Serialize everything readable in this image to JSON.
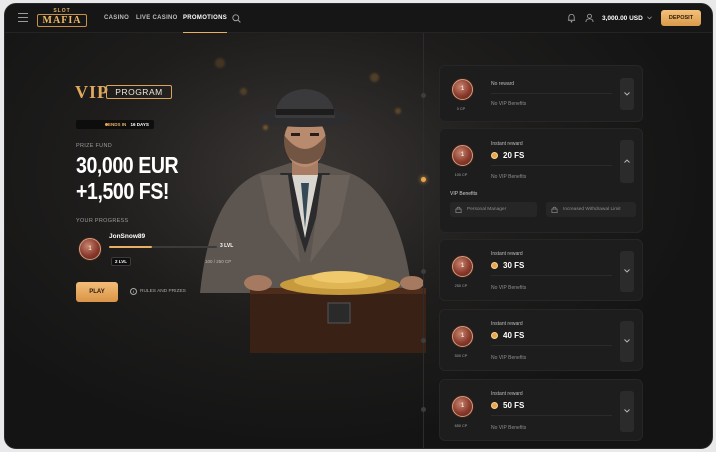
{
  "header": {
    "logo_top": "SLOT",
    "logo_main": "MAFIA",
    "nav": [
      "CASINO",
      "LIVE CASINO",
      "PROMOTIONS"
    ],
    "balance": "3,000.00 USD",
    "deposit_label": "DEPOSIT",
    "icons": [
      "menu-icon",
      "search-icon",
      "bell-icon",
      "user-icon",
      "chevron-down-icon"
    ]
  },
  "promo": {
    "vip_word": "VIP",
    "program_word": "PROGRAM",
    "ends_label": "ENDS IN",
    "ends_value": "16 DAYS",
    "prize_fund_label": "PRIZE FUND",
    "prize_line1": "30,000 EUR",
    "prize_line2": "+1,500 FS!",
    "your_progress_label": "YOUR PROGRESS",
    "user_level": "1",
    "username": "JonSnow89",
    "next_level": "3 LVL",
    "current_level_badge": "2 LVL",
    "cp_count": "100 / 250 CP",
    "progress_fraction": 0.4,
    "play_label": "PLAY",
    "rules_label": "RULES AND PRIZES"
  },
  "levels": [
    {
      "coin": "1",
      "cp": "0 CP",
      "title": "No reward",
      "fs": "",
      "benefits": "No VIP Benefits",
      "expanded": false
    },
    {
      "coin": "1",
      "cp": "100 CP",
      "title": "Instant reward",
      "fs": "20 FS",
      "benefits": "No VIP Benefits",
      "expanded": true,
      "vip_benefits_title": "VIP Benefits",
      "vip_benefits": [
        "Personal Manager",
        "Increased Withdrawal Limit"
      ]
    },
    {
      "coin": "1",
      "cp": "250 CP",
      "title": "Instant reward",
      "fs": "30 FS",
      "benefits": "No VIP Benefits",
      "expanded": false
    },
    {
      "coin": "1",
      "cp": "500 CP",
      "title": "Instant reward",
      "fs": "40 FS",
      "benefits": "No VIP Benefits",
      "expanded": false
    },
    {
      "coin": "1",
      "cp": "650 CP",
      "title": "Instant reward",
      "fs": "50 FS",
      "benefits": "No VIP Benefits",
      "expanded": false
    }
  ],
  "colors": {
    "accent": "#e7b062",
    "background": "#141414",
    "card": "#1d1d1d"
  }
}
